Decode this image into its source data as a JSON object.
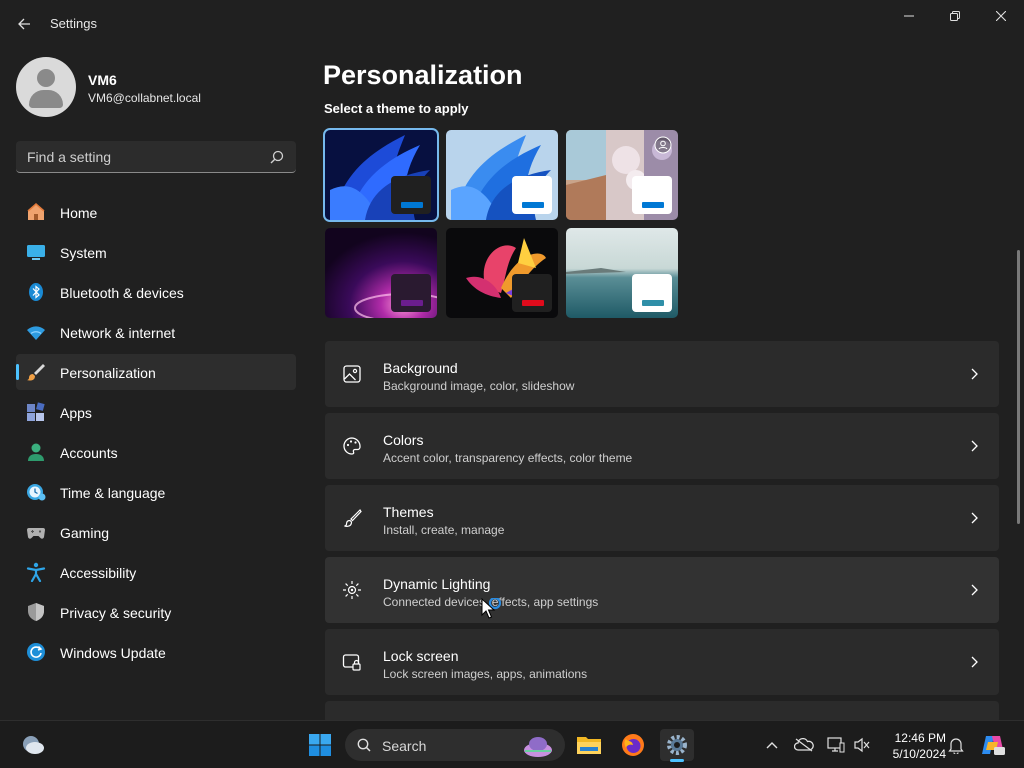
{
  "window": {
    "app_title": "Settings",
    "back_icon": "back-arrow-icon",
    "controls": [
      "minimize-icon",
      "restore-icon",
      "close-icon"
    ]
  },
  "profile": {
    "name": "VM6",
    "email": "VM6@collabnet.local"
  },
  "search": {
    "placeholder": "Find a setting"
  },
  "nav": {
    "items": [
      {
        "label": "Home",
        "icon": "home-icon"
      },
      {
        "label": "System",
        "icon": "system-icon"
      },
      {
        "label": "Bluetooth & devices",
        "icon": "bluetooth-icon"
      },
      {
        "label": "Network & internet",
        "icon": "network-icon"
      },
      {
        "label": "Personalization",
        "icon": "brush-icon",
        "active": true
      },
      {
        "label": "Apps",
        "icon": "apps-icon"
      },
      {
        "label": "Accounts",
        "icon": "accounts-icon"
      },
      {
        "label": "Time & language",
        "icon": "time-language-icon"
      },
      {
        "label": "Gaming",
        "icon": "gaming-icon"
      },
      {
        "label": "Accessibility",
        "icon": "accessibility-icon"
      },
      {
        "label": "Privacy & security",
        "icon": "shield-icon"
      },
      {
        "label": "Windows Update",
        "icon": "windows-update-icon"
      }
    ]
  },
  "main": {
    "title": "Personalization",
    "theme_section_label": "Select a theme to apply",
    "themes": [
      {
        "name": "windows-dark-bloom",
        "accent": "#0067c0",
        "selected": true
      },
      {
        "name": "windows-light-bloom",
        "accent": "#0067c0"
      },
      {
        "name": "windows-spotlight",
        "accent": "#0067c0"
      },
      {
        "name": "glow",
        "accent": "#6b1d8e"
      },
      {
        "name": "captured-motion",
        "accent": "#c30a14"
      },
      {
        "name": "flow",
        "accent": "#2f8fa8"
      }
    ],
    "cards": [
      {
        "title": "Background",
        "desc": "Background image, color, slideshow",
        "icon": "picture-icon"
      },
      {
        "title": "Colors",
        "desc": "Accent color, transparency effects, color theme",
        "icon": "palette-icon"
      },
      {
        "title": "Themes",
        "desc": "Install, create, manage",
        "icon": "brush-icon"
      },
      {
        "title": "Dynamic Lighting",
        "desc": "Connected devices, effects, app settings",
        "icon": "dynamic-lighting-icon"
      },
      {
        "title": "Lock screen",
        "desc": "Lock screen images, apps, animations",
        "icon": "lock-screen-icon"
      }
    ]
  },
  "taskbar": {
    "search_label": "Search",
    "time": "12:46 PM",
    "date": "5/10/2024",
    "pinned": [
      "start-icon",
      "file-explorer-icon",
      "firefox-icon",
      "settings-icon"
    ],
    "tray": [
      "chevron-up-icon",
      "onedrive-icon",
      "network-icon",
      "volume-icon",
      "notification-bell-icon",
      "copilot-icon"
    ]
  },
  "colors": {
    "accent": "#4cc2ff",
    "background": "#202020",
    "card": "#2b2b2b"
  }
}
